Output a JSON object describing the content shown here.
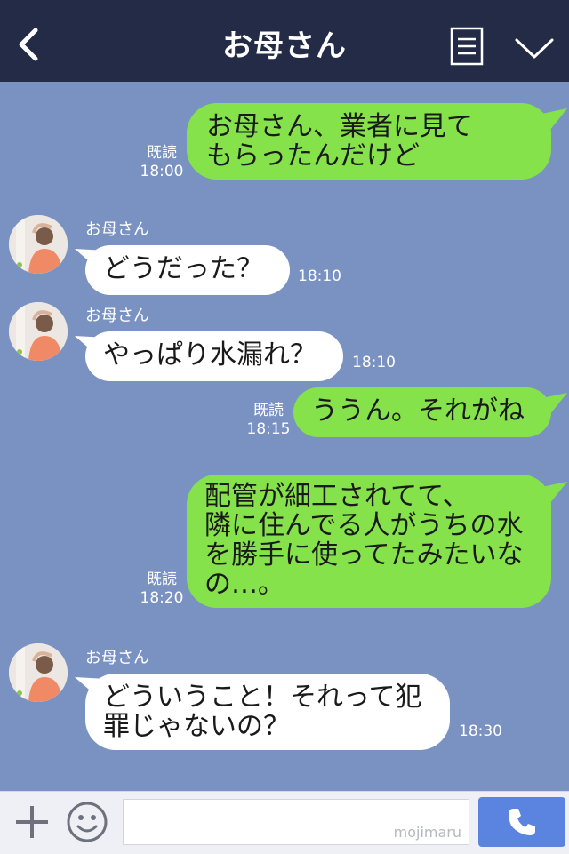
{
  "header": {
    "title": "お母さん",
    "back_icon": "back-chevron-icon",
    "menu_icon": "menu-list-icon",
    "collapse_icon": "chevron-down-icon"
  },
  "messages": [
    {
      "direction": "out",
      "text": "お母さん、業者に見て\nもらったんだけど",
      "read": "既読",
      "time": "18:00"
    },
    {
      "direction": "in",
      "sender": "お母さん",
      "text": "どうだった？",
      "time": "18:10"
    },
    {
      "direction": "in",
      "sender": "お母さん",
      "text": "やっぱり水漏れ？",
      "time": "18:10"
    },
    {
      "direction": "out",
      "text": "ううん。それがね",
      "read": "既読",
      "time": "18:15"
    },
    {
      "direction": "out",
      "text": "配管が細工されてて、\n隣に住んでる人がうちの水\nを勝手に使ってたみたいな\nの…。",
      "read": "既読",
      "time": "18:20"
    },
    {
      "direction": "in",
      "sender": "お母さん",
      "text": "どういうこと！それって犯\n罪じゃないの？",
      "time": "18:30"
    }
  ],
  "input_bar": {
    "placeholder": "",
    "watermark": "mojimaru",
    "plus_icon": "plus-icon",
    "emoji_icon": "smile-icon",
    "call_icon": "phone-icon"
  },
  "colors": {
    "header_bg": "#232b46",
    "chat_bg": "#7a92c2",
    "outgoing_bubble": "#86e24a",
    "incoming_bubble": "#ffffff",
    "call_button": "#5b84e0"
  }
}
